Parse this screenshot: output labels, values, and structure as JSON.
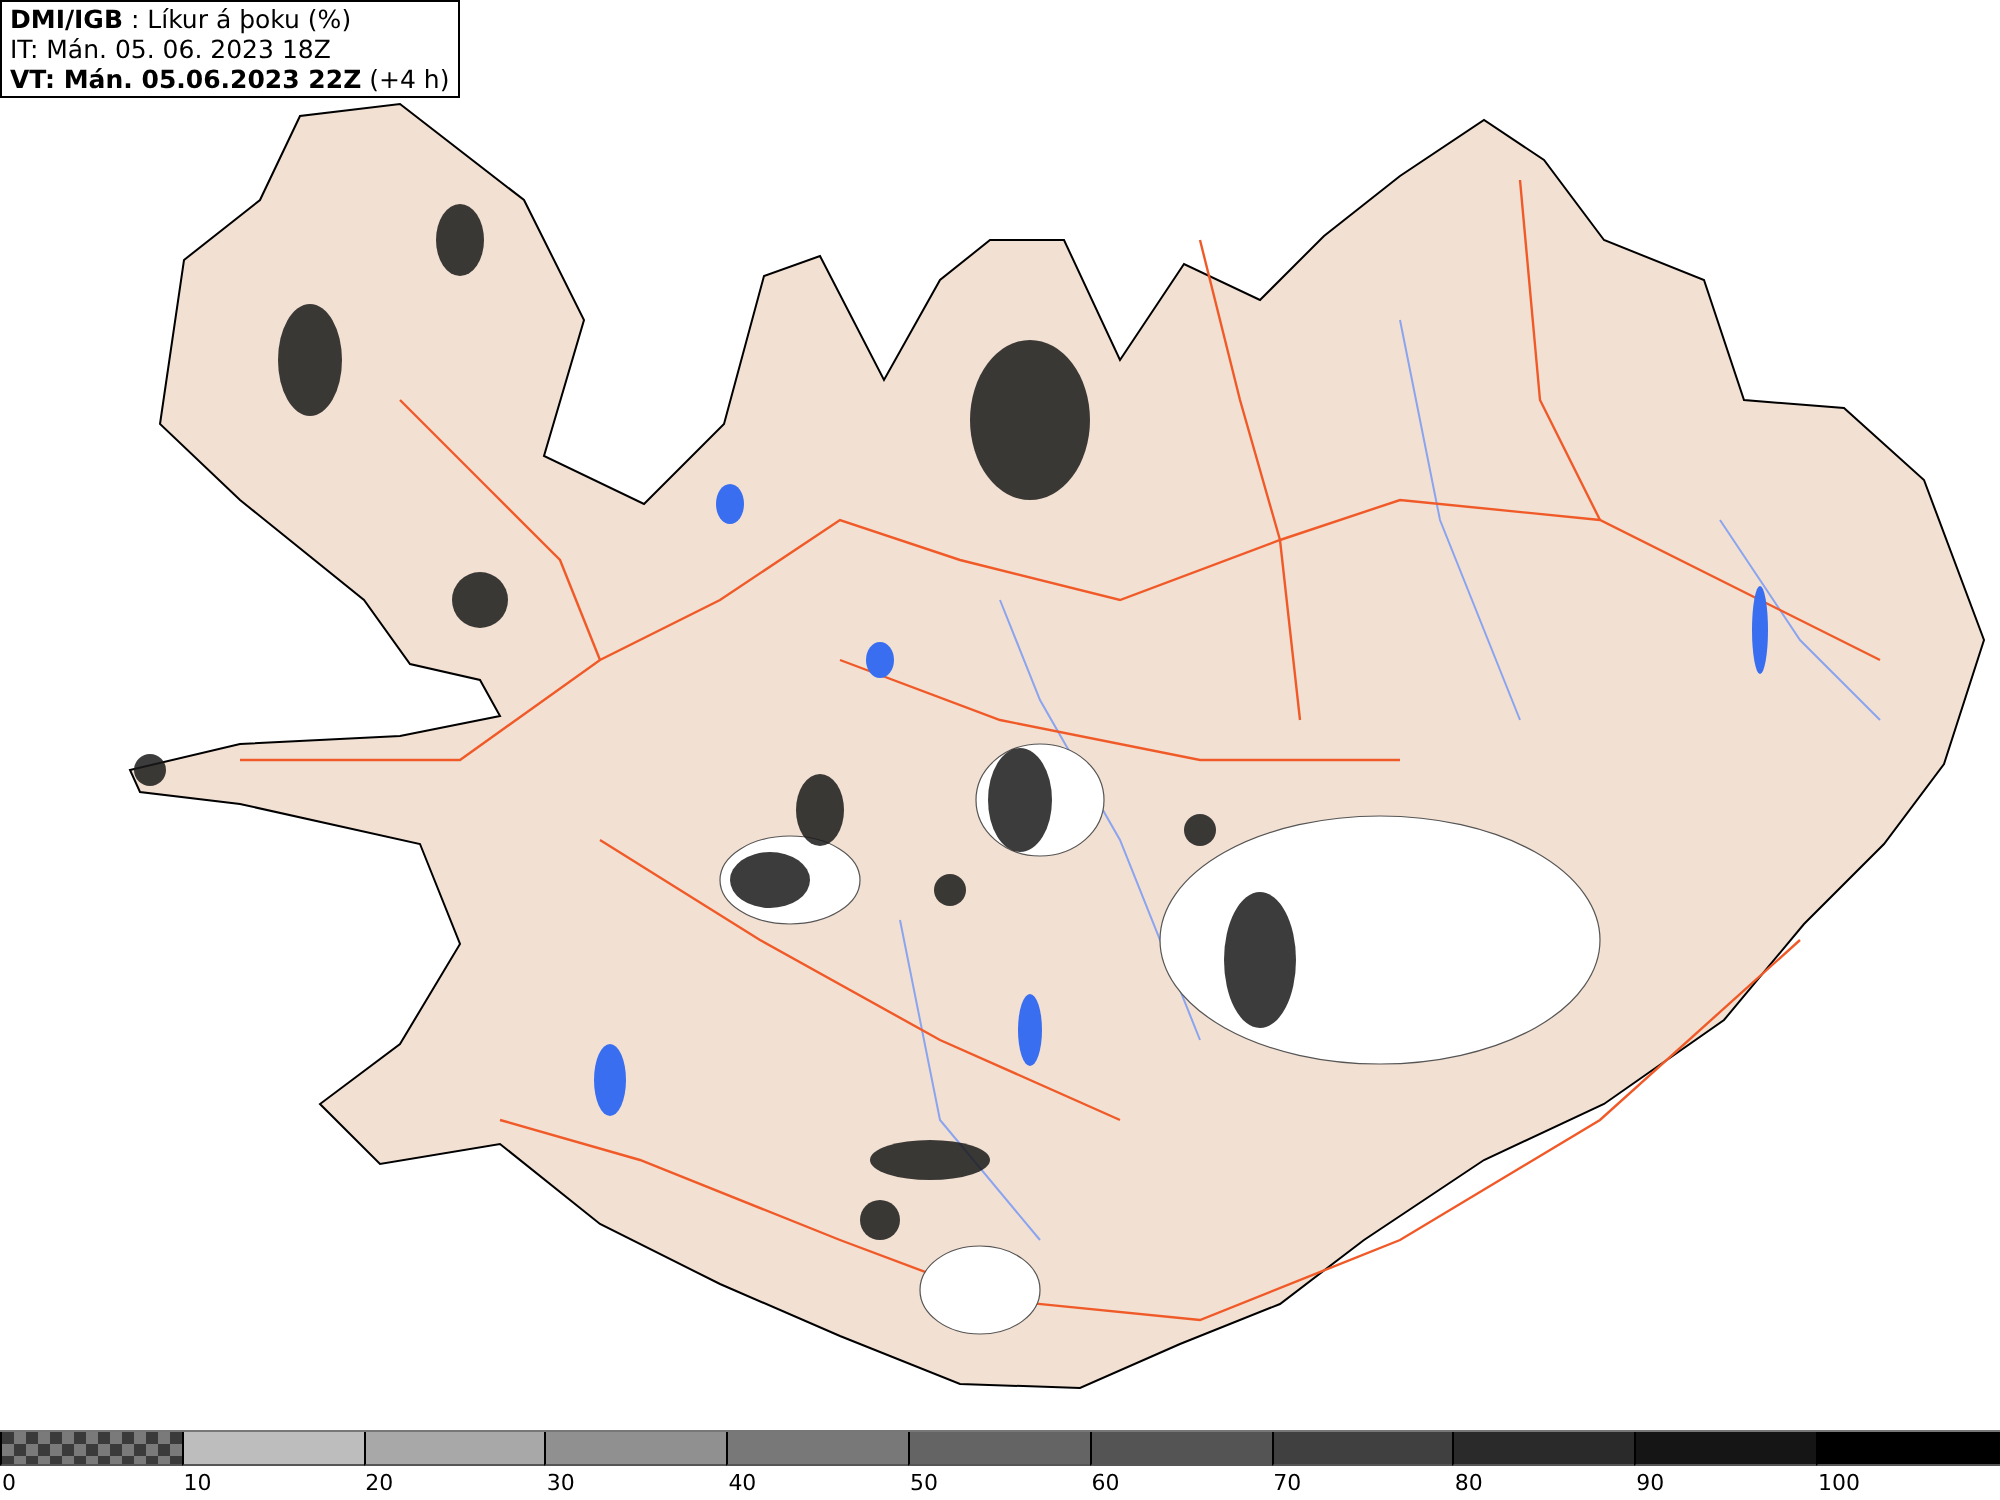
{
  "header": {
    "lines": [
      "**DMI/IGB** : Líkur á þoku (%)",
      "IT: Mán. 05. 06. 2023 18Z",
      "**VT: Mán. 05.06.2023 22Z** (+4 h)"
    ]
  },
  "legend": {
    "bins": [
      {
        "kind": "checker",
        "label": "0"
      },
      {
        "kind": "solid",
        "color": "#bdbdbd",
        "label": "10"
      },
      {
        "kind": "solid",
        "color": "#a8a8a8",
        "label": "20"
      },
      {
        "kind": "solid",
        "color": "#909090",
        "label": "30"
      },
      {
        "kind": "solid",
        "color": "#787878",
        "label": "40"
      },
      {
        "kind": "solid",
        "color": "#646464",
        "label": "50"
      },
      {
        "kind": "solid",
        "color": "#545454",
        "label": "60"
      },
      {
        "kind": "solid",
        "color": "#404040",
        "label": "70"
      },
      {
        "kind": "solid",
        "color": "#2a2a2a",
        "label": "80"
      },
      {
        "kind": "solid",
        "color": "#151515",
        "label": "90"
      },
      {
        "kind": "solid",
        "color": "#000000",
        "label": "100"
      }
    ]
  }
}
